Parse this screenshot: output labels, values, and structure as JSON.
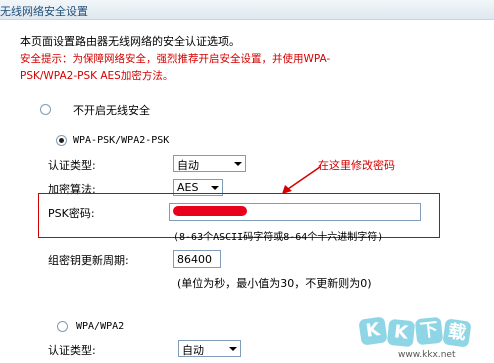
{
  "header": {
    "title": "无线网络安全设置"
  },
  "intro": "本页面设置路由器无线网络的安全认证选项。",
  "warning": {
    "line1": "安全提示：为保障网络安全，强烈推荐开启安全设置，并使用WPA-",
    "line2": "PSK/WPA2-PSK AES加密方法。"
  },
  "options": {
    "disable_label": "不开启无线安全",
    "wpa_psk_label": "WPA-PSK/WPA2-PSK",
    "wpa_label": "WPA/WPA2"
  },
  "wpa_psk": {
    "auth_type_label": "认证类型:",
    "auth_type_value": "自动",
    "encryption_label": "加密算法:",
    "encryption_value": "AES",
    "psk_label": "PSK密码:",
    "psk_hint": "(8-63个ASCII码字符或8-64个十六进制字符)",
    "renew_label": "组密钥更新周期:",
    "renew_value": "86400",
    "renew_hint": "(单位为秒，最小值为30，不更新则为0)"
  },
  "wpa": {
    "auth_type_label": "认证类型:",
    "auth_type_value": "自动"
  },
  "annotation": {
    "text": "在这里修改密码",
    "color": "#d40000"
  },
  "watermark": {
    "tiles": [
      "K",
      "K",
      "下",
      "载"
    ],
    "url": "www.kkx.net"
  },
  "colors": {
    "accent_red": "#d40000",
    "redaction": "#e8001c",
    "header_text": "#1f4e79"
  }
}
